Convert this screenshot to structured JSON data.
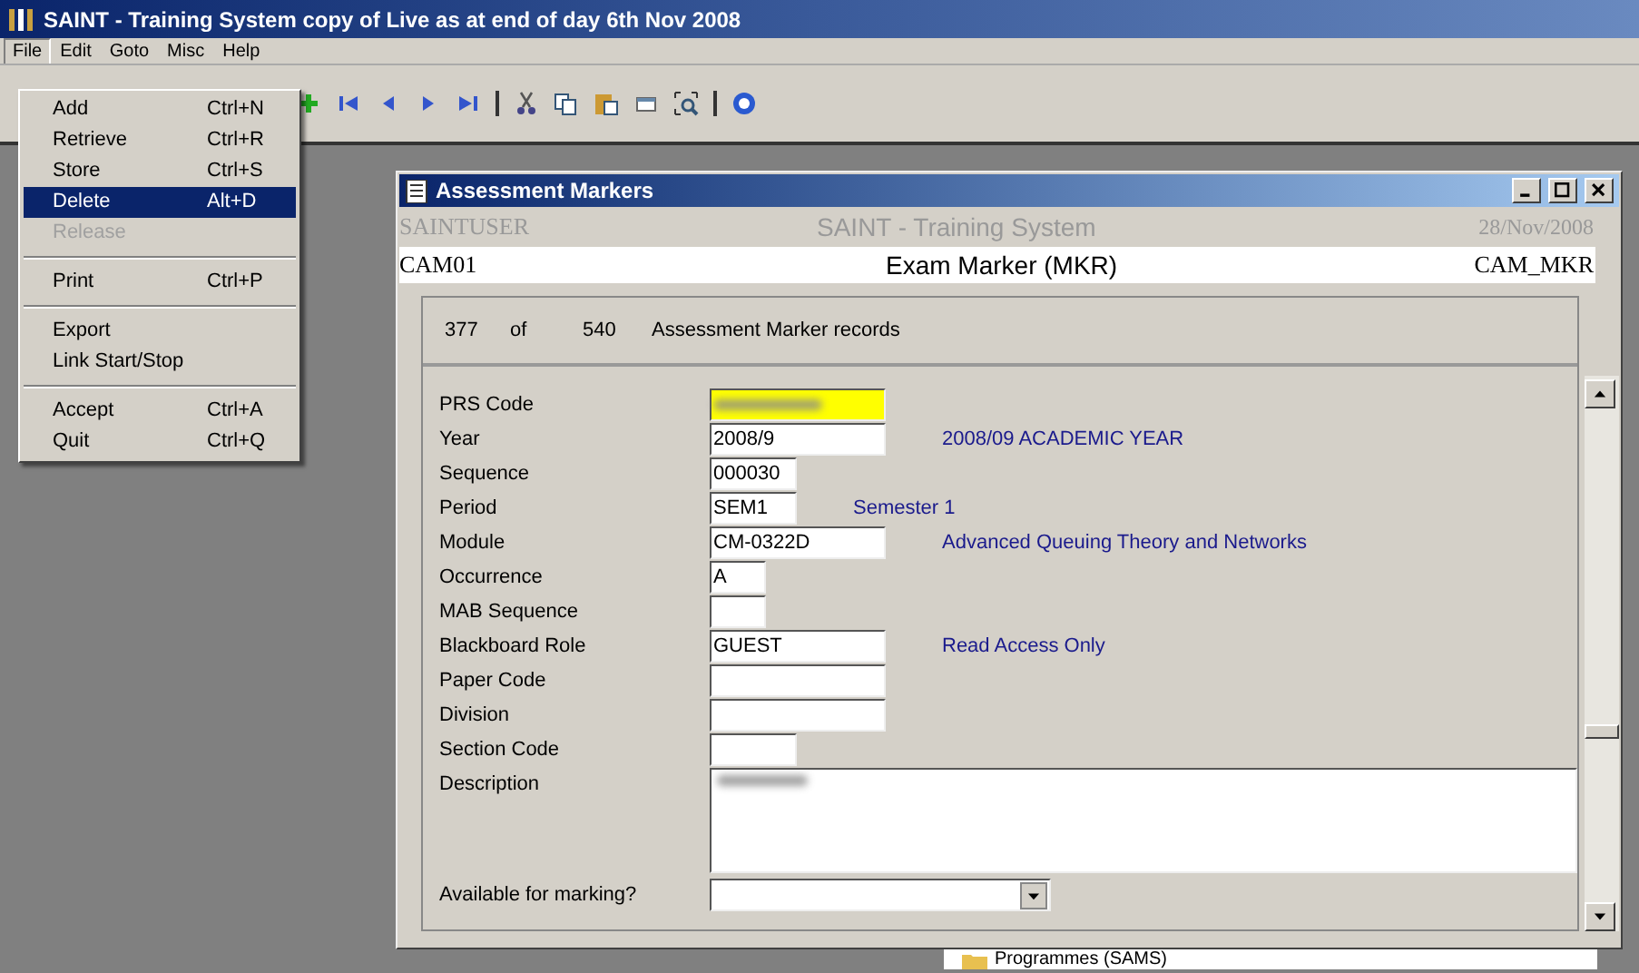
{
  "window": {
    "title": "SAINT - Training System copy of Live as at end of day 6th Nov 2008"
  },
  "menubar": [
    {
      "label": "File",
      "selected": true
    },
    {
      "label": "Edit",
      "selected": false
    },
    {
      "label": "Goto",
      "selected": false
    },
    {
      "label": "Misc",
      "selected": false
    },
    {
      "label": "Help",
      "selected": false
    }
  ],
  "file_menu": [
    {
      "kind": "item",
      "label": "Add",
      "shortcut": "Ctrl+N",
      "selected": false,
      "disabled": false
    },
    {
      "kind": "item",
      "label": "Retrieve",
      "shortcut": "Ctrl+R",
      "selected": false,
      "disabled": false
    },
    {
      "kind": "item",
      "label": "Store",
      "shortcut": "Ctrl+S",
      "selected": false,
      "disabled": false
    },
    {
      "kind": "item",
      "label": "Delete",
      "shortcut": "Alt+D",
      "selected": true,
      "disabled": false
    },
    {
      "kind": "item",
      "label": "Release",
      "selected": false,
      "disabled": true
    },
    {
      "kind": "separator"
    },
    {
      "kind": "item",
      "label": "Print",
      "shortcut": "Ctrl+P",
      "selected": false,
      "disabled": false
    },
    {
      "kind": "separator"
    },
    {
      "kind": "item",
      "label": "Export",
      "selected": false,
      "disabled": false
    },
    {
      "kind": "item",
      "label": "Link Start/Stop",
      "selected": false,
      "disabled": false
    },
    {
      "kind": "separator"
    },
    {
      "kind": "item",
      "label": "Accept",
      "shortcut": "Ctrl+A",
      "selected": false,
      "disabled": false
    },
    {
      "kind": "item",
      "label": "Quit",
      "shortcut": "Ctrl+Q",
      "selected": false,
      "disabled": false
    }
  ],
  "dialog": {
    "title": "Assessment Markers",
    "header": {
      "user": "SAINTUSER",
      "system": "SAINT - Training System",
      "date": "28/Nov/2008",
      "code": "CAM01",
      "role": "Exam Marker (MKR)",
      "role_code": "CAM_MKR"
    },
    "record_count": {
      "current": "377",
      "of": "of",
      "total": "540",
      "label": "Assessment Marker records"
    },
    "fields": [
      {
        "kind": "long",
        "label": "PRS Code",
        "highlighted": true,
        "blurred": true
      },
      {
        "kind": "long",
        "label": "Year",
        "value": "2008/9",
        "description": "2008/09 ACADEMIC YEAR",
        "highlighted": false,
        "blurred": false
      },
      {
        "kind": "short",
        "label": "Sequence",
        "value": "000030",
        "highlighted": false,
        "blurred": false
      },
      {
        "kind": "short",
        "label": "Period",
        "value": "SEM1",
        "description": "Semester 1",
        "highlighted": false,
        "blurred": false
      },
      {
        "kind": "long",
        "label": "Module",
        "value": "CM-0322D",
        "description": "Advanced Queuing Theory and Networks",
        "highlighted": false,
        "blurred": false
      },
      {
        "kind": "tiny",
        "label": "Occurrence",
        "value": "A",
        "highlighted": false,
        "blurred": false
      },
      {
        "kind": "tiny",
        "label": "MAB Sequence",
        "highlighted": false,
        "blurred": false
      },
      {
        "kind": "long",
        "label": "Blackboard Role",
        "value": "GUEST",
        "description": "Read Access Only",
        "highlighted": false,
        "blurred": false
      },
      {
        "kind": "long",
        "label": "Paper Code",
        "highlighted": false,
        "blurred": false
      },
      {
        "kind": "long",
        "label": "Division",
        "highlighted": false,
        "blurred": false
      },
      {
        "kind": "short",
        "label": "Section Code",
        "highlighted": false,
        "blurred": false
      },
      {
        "kind": "textarea",
        "label": "Description",
        "highlighted": false,
        "blurred": true
      },
      {
        "kind": "dropdown",
        "label": "Available for marking?",
        "highlighted": false,
        "blurred": false
      }
    ]
  },
  "background_tree": {
    "item": "Programmes (SAMS)"
  }
}
